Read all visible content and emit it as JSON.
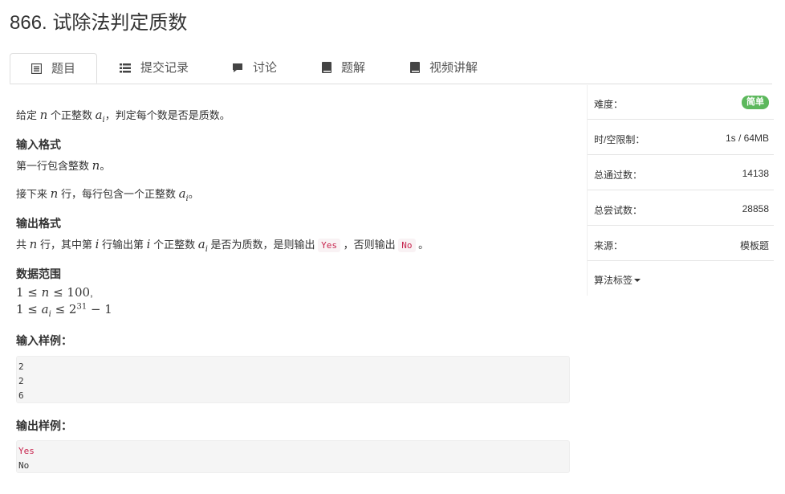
{
  "title": "866. 试除法判定质数",
  "tabs": [
    {
      "label": "题目",
      "icon": "list-alt-icon"
    },
    {
      "label": "提交记录",
      "icon": "list-icon"
    },
    {
      "label": "讨论",
      "icon": "comment-icon"
    },
    {
      "label": "题解",
      "icon": "book-icon"
    },
    {
      "label": "视频讲解",
      "icon": "book-icon"
    }
  ],
  "problem": {
    "desc_a": "给定",
    "desc_n": "n",
    "desc_b": "个正整数",
    "desc_ai": "a",
    "desc_ai_sub": "i",
    "desc_c": "，判定每个数是否是质数。",
    "input_heading": "输入格式",
    "input_line1_a": "第一行包含整数",
    "input_line1_n": "n",
    "input_line1_b": "。",
    "input_line2_a": "接下来",
    "input_line2_n": "n",
    "input_line2_b": "行，每行包含一个正整数",
    "input_line2_ai": "a",
    "input_line2_sub": "i",
    "input_line2_c": "。",
    "output_heading": "输出格式",
    "output_a": "共",
    "output_n": "n",
    "output_b": "行，其中第",
    "output_i": "i",
    "output_c": "行输出第",
    "output_i2": "i",
    "output_d": "个正整数",
    "output_ai": "a",
    "output_sub": "i",
    "output_e": "是否为质数，是则输出",
    "output_yes": "Yes",
    "output_f": "，否则输出",
    "output_no": "No",
    "output_g": "。",
    "range_heading": "数据范围",
    "range1_a": "1 ≤ ",
    "range1_n": "n",
    "range1_b": " ≤ 100",
    "range1_c": ",",
    "range2_a": "1 ≤ ",
    "range2_ai": "a",
    "range2_sub": "i",
    "range2_b": " ≤ 2",
    "range2_sup": "31",
    "range2_c": " − 1",
    "sample_in_heading": "输入样例：",
    "sample_in": [
      "2",
      "2",
      "6"
    ],
    "sample_out_heading": "输出样例：",
    "sample_out": [
      "Yes",
      "No"
    ]
  },
  "info": {
    "difficulty_label": "难度：",
    "difficulty_value": "简单",
    "limit_label": "时/空限制：",
    "limit_value": "1s / 64MB",
    "passed_label": "总通过数：",
    "passed_value": "14138",
    "tries_label": "总尝试数：",
    "tries_value": "28858",
    "source_label": "来源：",
    "source_value": "模板题",
    "tags_label": "算法标签"
  },
  "colors": {
    "badge": "#5cb85c",
    "code_text": "#c7254e"
  }
}
